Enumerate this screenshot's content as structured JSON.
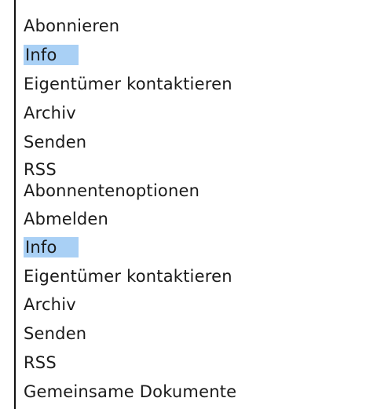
{
  "menus": [
    {
      "items": [
        {
          "label": "Abonnieren",
          "selected": false
        },
        {
          "label": "Info",
          "selected": true
        },
        {
          "label": "Eigentümer kontaktieren",
          "selected": false
        },
        {
          "label": "Archiv",
          "selected": false
        },
        {
          "label": "Senden",
          "selected": false
        },
        {
          "label": "RSS",
          "selected": false
        }
      ]
    },
    {
      "items": [
        {
          "label": "Abonnentenoptionen",
          "selected": false
        },
        {
          "label": "Abmelden",
          "selected": false
        },
        {
          "label": "Info",
          "selected": true
        },
        {
          "label": "Eigentümer kontaktieren",
          "selected": false
        },
        {
          "label": "Archiv",
          "selected": false
        },
        {
          "label": "Senden",
          "selected": false
        },
        {
          "label": "RSS",
          "selected": false
        },
        {
          "label": "Gemeinsame Dokumente",
          "selected": false
        }
      ]
    }
  ],
  "colors": {
    "selected_background": "#a9d0f5",
    "text": "#1a1a1a",
    "rule": "#111111"
  }
}
